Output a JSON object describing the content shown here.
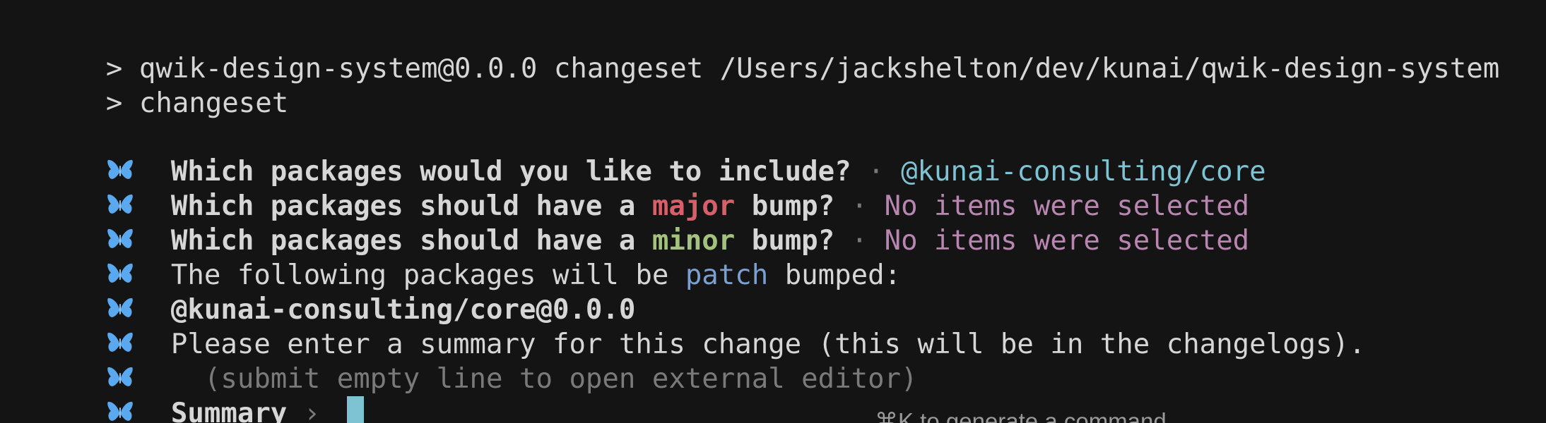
{
  "header": {
    "line1": "> qwik-design-system@0.0.0 changeset /Users/jackshelton/dev/kunai/qwik-design-system",
    "line2": "> changeset"
  },
  "prompts": {
    "include_q": "Which packages would you like to include?",
    "sep": " · ",
    "include_answer": "@kunai-consulting/core",
    "major_pre": "Which packages should have a ",
    "major_word": "major",
    "major_post": " bump?",
    "major_answer": "No items were selected",
    "minor_pre": "Which packages should have a ",
    "minor_word": "minor",
    "minor_post": " bump?",
    "minor_answer": "No items were selected",
    "patch_pre": "The following packages will be ",
    "patch_word": "patch",
    "patch_post": " bumped:",
    "patch_package": "@kunai-consulting/core@0.0.0",
    "summary_request": "Please enter a summary for this change (this will be in the changelogs).",
    "summary_hint": "  (submit empty line to open external editor)",
    "summary_label": "Summary",
    "summary_arrow": " › ",
    "summary_value": ""
  },
  "footer": {
    "hint": "⌘K to generate a command"
  },
  "icons": {
    "bullet": "butterfly-icon"
  },
  "colors": {
    "background": "#141414",
    "foreground": "#d6d6d6",
    "cyan": "#7ec3d3",
    "red": "#d4606a",
    "green": "#a3c27e",
    "magenta": "#b886b0",
    "blue": "#7b9fd0",
    "butterfly": "#5aa9f0"
  }
}
